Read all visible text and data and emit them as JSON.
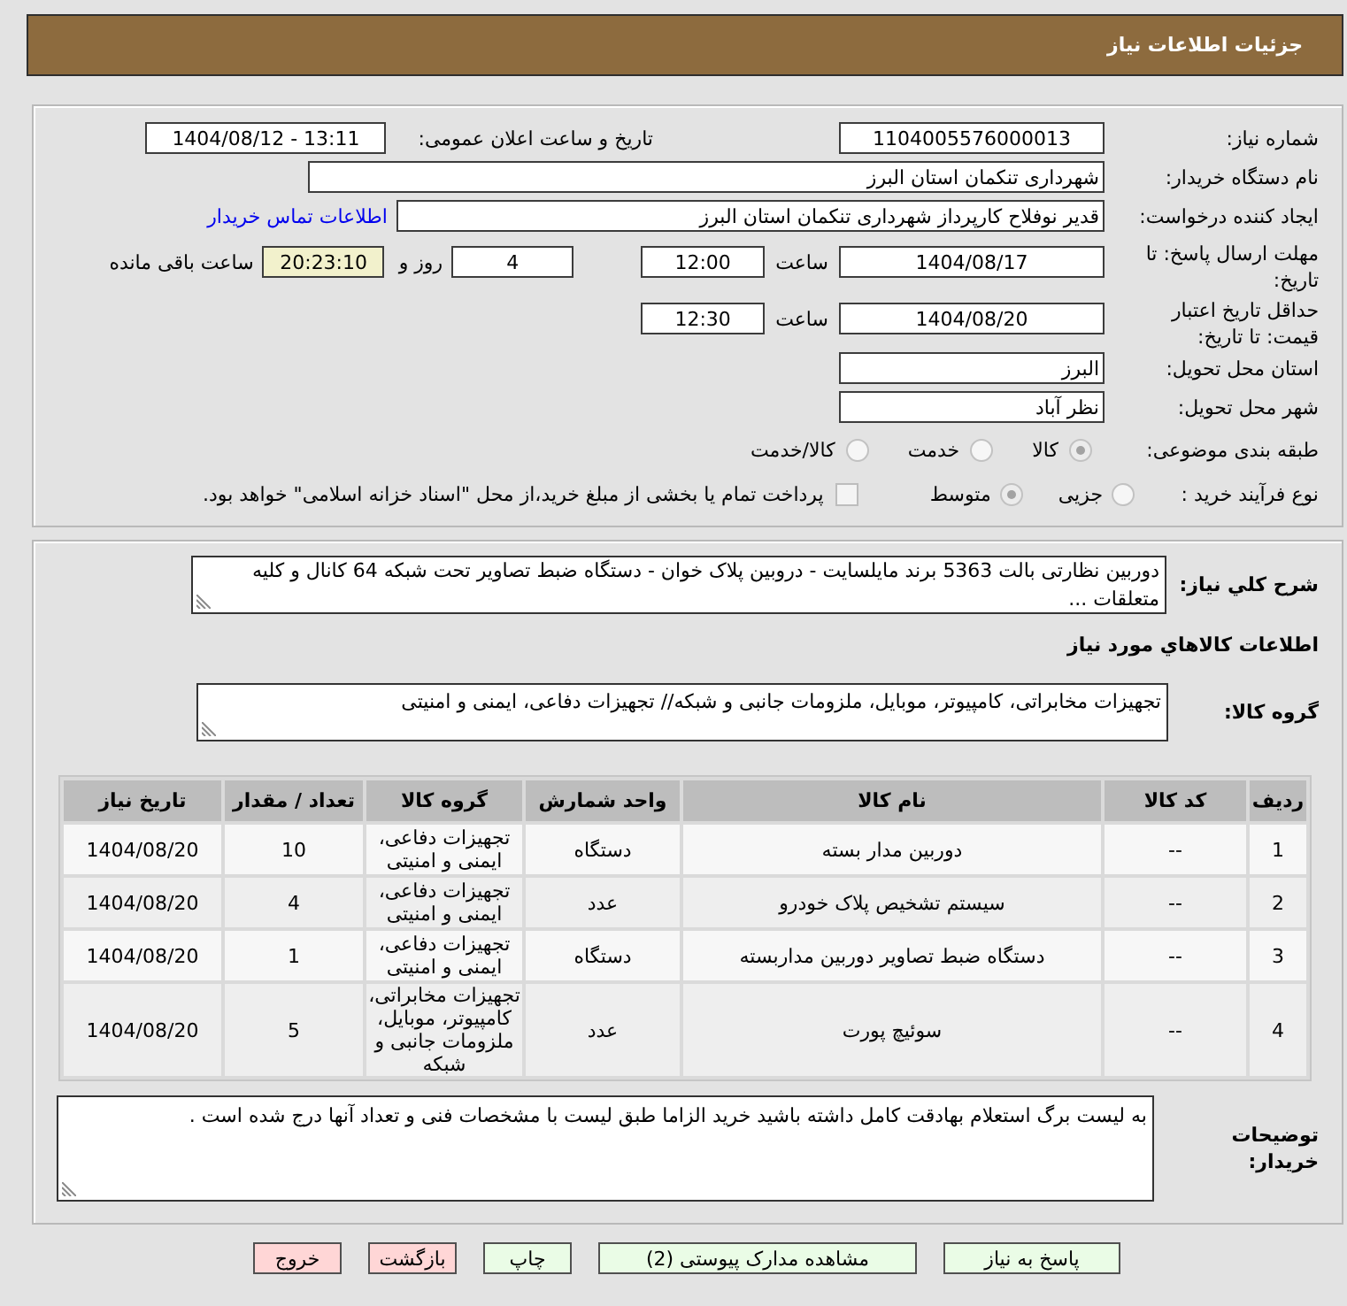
{
  "header": {
    "title": "جزئیات اطلاعات نیاز"
  },
  "details": {
    "need_number": {
      "label": "شماره نیاز:",
      "value": "1104005576000013"
    },
    "announcement": {
      "label": "تاریخ و ساعت اعلان عمومی:",
      "value": "1404/08/12 - 13:11"
    },
    "buyer_org": {
      "label": "نام دستگاه خریدار:",
      "value": "شهرداری تنکمان استان البرز"
    },
    "requester": {
      "label": "ایجاد کننده درخواست:",
      "value": "قدیر نوفلاح کارپرداز شهرداری تنکمان استان البرز",
      "link": "اطلاعات تماس خریدار"
    },
    "reply_deadline": {
      "label": "مهلت ارسال پاسخ: تا تاریخ:",
      "date": "1404/08/17",
      "time_label": "ساعت",
      "time": "12:00",
      "days": "4",
      "days_label": "روز و",
      "remaining": "20:23:10",
      "remaining_label": "ساعت باقی مانده"
    },
    "price_validity": {
      "label": "حداقل تاریخ اعتبار قیمت: تا تاریخ:",
      "date": "1404/08/20",
      "time_label": "ساعت",
      "time": "12:30"
    },
    "delivery_province": {
      "label": "استان محل تحویل:",
      "value": "البرز"
    },
    "delivery_city": {
      "label": "شهر محل تحویل:",
      "value": "نظر آباد"
    },
    "category": {
      "label": "طبقه بندی موضوعی:",
      "options": [
        {
          "label": "کالا",
          "selected": true
        },
        {
          "label": "خدمت",
          "selected": false
        },
        {
          "label": "کالا/خدمت",
          "selected": false
        }
      ]
    },
    "purchase_process": {
      "label": "نوع فرآیند خرید :",
      "options": [
        {
          "label": "جزیی",
          "selected": false
        },
        {
          "label": "متوسط",
          "selected": true
        }
      ],
      "treasury_payment": {
        "label": "پرداخت تمام یا بخشی از مبلغ خرید،از محل \"اسناد خزانه اسلامی\" خواهد بود.",
        "checked": false
      }
    }
  },
  "description": {
    "label": "شرح کلي نياز:",
    "value": "دوربین نظارتی بالت 5363 برند مایلسایت - دروبین پلاک خوان - دستگاه ضبط تصاویر تحت شبکه 64 کانال و کلیه متعلقات ..."
  },
  "goods": {
    "title": "اطلاعات کالاهاي مورد نياز",
    "group_label": "گروه کالا:",
    "group_value": "تجهیزات مخابراتی، کامپیوتر، موبایل، ملزومات جانبی و شبکه// تجهیزات دفاعی، ایمنی و امنیتی",
    "table": {
      "columns": [
        "ردیف",
        "کد کالا",
        "نام کالا",
        "واحد شمارش",
        "گروه کالا",
        "تعداد / مقدار",
        "تاریخ نیاز"
      ],
      "rows": [
        [
          "1",
          "--",
          "دوربین مدار بسته",
          "دستگاه",
          "تجهیزات دفاعی، ایمنی و امنیتی",
          "10",
          "1404/08/20"
        ],
        [
          "2",
          "--",
          "سیستم تشخیص پلاک خودرو",
          "عدد",
          "تجهیزات دفاعی، ایمنی و امنیتی",
          "4",
          "1404/08/20"
        ],
        [
          "3",
          "--",
          "دستگاه ضبط تصاویر دوربین مداربسته",
          "دستگاه",
          "تجهیزات دفاعی، ایمنی و امنیتی",
          "1",
          "1404/08/20"
        ],
        [
          "4",
          "--",
          "سوئیچ پورت",
          "عدد",
          "تجهیزات مخابراتی، کامپیوتر، موبایل، ملزومات جانبی و شبکه",
          "5",
          "1404/08/20"
        ]
      ]
    }
  },
  "buyer_notes": {
    "label": "توضیحات خریدار:",
    "value": "به لیست برگ استعلام بهادقت کامل داشته باشید خرید الزاما طبق لیست با مشخصات فنی و تعداد آنها درج شده است ."
  },
  "buttons": [
    {
      "label": "پاسخ به نیاز",
      "kind": "action"
    },
    {
      "label": "مشاهده مدارک پیوستی (2)",
      "kind": "action"
    },
    {
      "label": "چاپ",
      "kind": "action"
    },
    {
      "label": "بازگشت",
      "kind": "leave"
    },
    {
      "label": "خروج",
      "kind": "leave"
    }
  ]
}
